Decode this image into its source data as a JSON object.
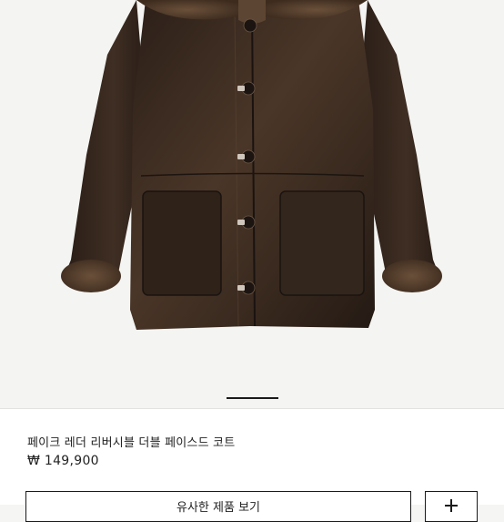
{
  "product": {
    "title": "페이크 레더 리버시블 더블 페이스드 코트",
    "price": "₩ 149,900"
  },
  "gallery": {
    "image": "brown-faux-leather-shearling-coat",
    "active_page": 1
  },
  "actions": {
    "similar_label": "유사한 제품 보기",
    "square_icon": "add-icon"
  },
  "colors": {
    "leather": "#3a2a20",
    "shearling": "#5a4230",
    "background": "#f4f4f2"
  }
}
